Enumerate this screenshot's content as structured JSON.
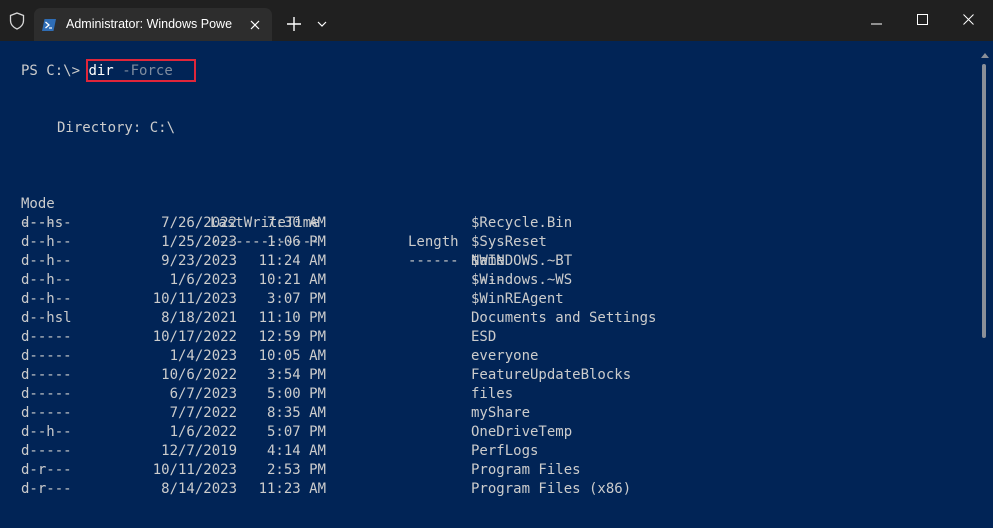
{
  "titlebar": {
    "tab_title": "Administrator: Windows Powe"
  },
  "terminal": {
    "prompt": "PS C:\\>",
    "command": "dir",
    "parameter": "-Force",
    "directory_line": "Directory: C:\\",
    "columns": {
      "mode": "Mode",
      "last_write_time": "LastWriteTime",
      "length": "Length",
      "name": "Name"
    },
    "separators": {
      "mode": "----",
      "last_write_time": "-------------",
      "length": "------",
      "name": "----"
    },
    "rows": [
      {
        "mode": "d--hs-",
        "date": "7/26/2022",
        "time": "7:30 AM",
        "name": "$Recycle.Bin"
      },
      {
        "mode": "d--h--",
        "date": "1/25/2023",
        "time": "1:06 PM",
        "name": "$SysReset"
      },
      {
        "mode": "d--h--",
        "date": "9/23/2023",
        "time": "11:24 AM",
        "name": "$WINDOWS.~BT"
      },
      {
        "mode": "d--h--",
        "date": "1/6/2023",
        "time": "10:21 AM",
        "name": "$Windows.~WS"
      },
      {
        "mode": "d--h--",
        "date": "10/11/2023",
        "time": "3:07 PM",
        "name": "$WinREAgent"
      },
      {
        "mode": "d--hsl",
        "date": "8/18/2021",
        "time": "11:10 PM",
        "name": "Documents and Settings"
      },
      {
        "mode": "d-----",
        "date": "10/17/2022",
        "time": "12:59 PM",
        "name": "ESD"
      },
      {
        "mode": "d-----",
        "date": "1/4/2023",
        "time": "10:05 AM",
        "name": "everyone"
      },
      {
        "mode": "d-----",
        "date": "10/6/2022",
        "time": "3:54 PM",
        "name": "FeatureUpdateBlocks"
      },
      {
        "mode": "d-----",
        "date": "6/7/2023",
        "time": "5:00 PM",
        "name": "files"
      },
      {
        "mode": "d-----",
        "date": "7/7/2022",
        "time": "8:35 AM",
        "name": "myShare"
      },
      {
        "mode": "d--h--",
        "date": "1/6/2022",
        "time": "5:07 PM",
        "name": "OneDriveTemp"
      },
      {
        "mode": "d-----",
        "date": "12/7/2019",
        "time": "4:14 AM",
        "name": "PerfLogs"
      },
      {
        "mode": "d-r---",
        "date": "10/11/2023",
        "time": "2:53 PM",
        "name": "Program Files"
      },
      {
        "mode": "d-r---",
        "date": "8/14/2023",
        "time": "11:23 AM",
        "name": "Program Files (x86)"
      }
    ]
  },
  "colors": {
    "terminal_bg": "#012456",
    "titlebar_bg": "#202020",
    "tab_bg": "#2d2d2d",
    "text": "#cccccc",
    "highlight": "#e0263a"
  },
  "icons": {
    "shield": "shield-icon",
    "powershell": "powershell-icon",
    "tab_close": "close-icon",
    "new_tab": "plus-icon",
    "dropdown": "chevron-down-icon",
    "minimize": "minimize-icon",
    "maximize": "maximize-icon",
    "close": "close-icon"
  }
}
